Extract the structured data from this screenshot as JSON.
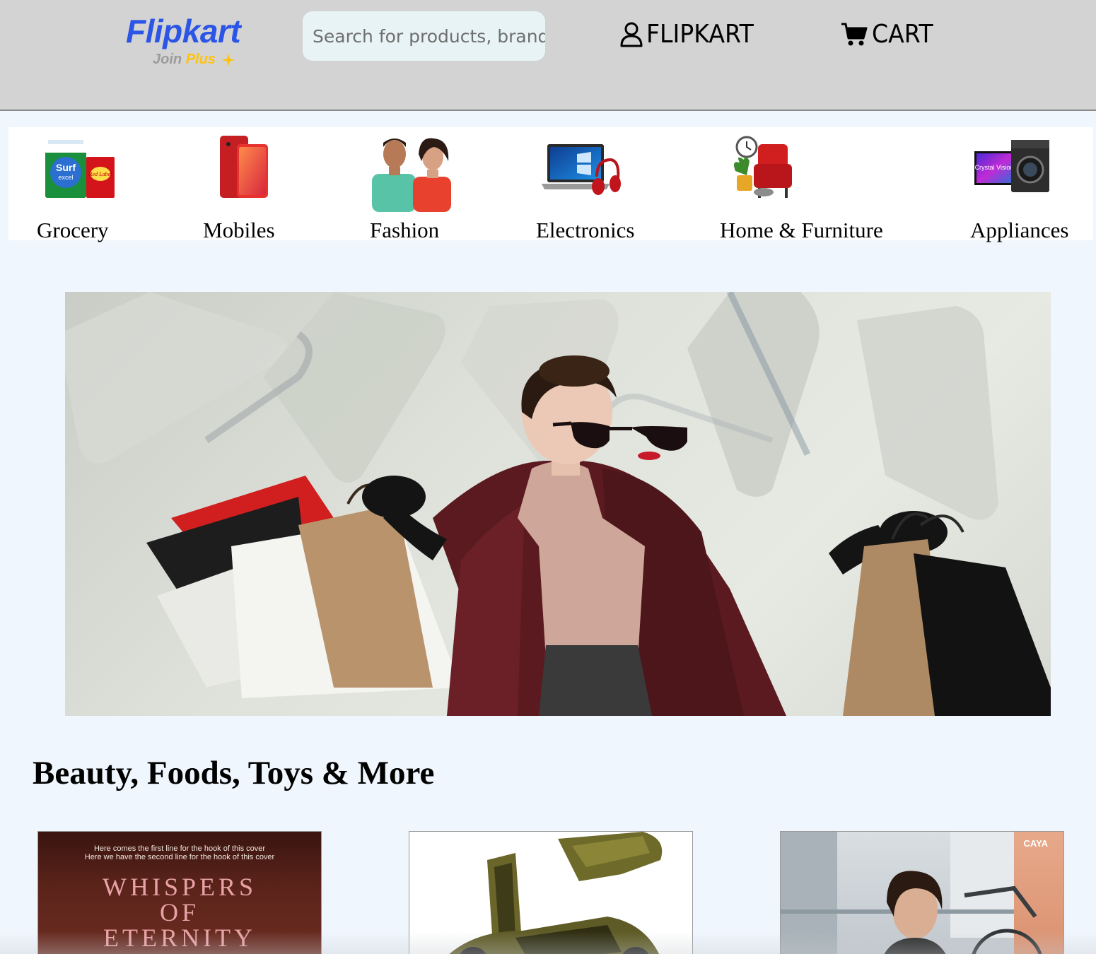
{
  "header": {
    "logo_text": "Flipkart",
    "logo_sub_join": "Join",
    "logo_sub_plus": "Plus",
    "search_placeholder": "Search for products, brands and more",
    "account_label": "FLIPKART",
    "cart_label": "CART",
    "icons": {
      "account": "user-icon",
      "cart": "cart-icon"
    }
  },
  "categories": [
    {
      "label": "Grocery",
      "icon": "grocery-icon"
    },
    {
      "label": "Mobiles",
      "icon": "mobile-phone-icon"
    },
    {
      "label": "Fashion",
      "icon": "fashion-models-icon"
    },
    {
      "label": "Electronics",
      "icon": "laptop-headphones-icon"
    },
    {
      "label": "Home & Furniture",
      "icon": "armchair-icon"
    },
    {
      "label": "Appliances",
      "icon": "tv-washer-icon"
    }
  ],
  "hero": {
    "image": "woman-with-shopping-bags"
  },
  "section": {
    "title": "Beauty, Foods, Toys & More",
    "cards": [
      {
        "image": "book-cover",
        "hook_line_1": "Here comes the first line for the hook of this cover",
        "hook_line_2": "Here we have the second line for the hook of this cover",
        "title_line_1": "Whispers",
        "title_line_2": "of",
        "title_line_3": "Eternity"
      },
      {
        "image": "toy-car"
      },
      {
        "image": "bicycle",
        "brand": "CAYA"
      }
    ]
  },
  "colors": {
    "header_bg": "#d3d3d3",
    "page_bg": "#f0f6fd",
    "logo_blue": "#2b55e6",
    "plus_yellow": "#ffc20e",
    "search_bg": "#e8f3f5"
  }
}
